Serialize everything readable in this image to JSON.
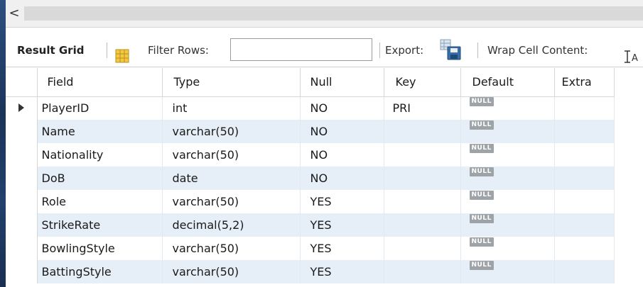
{
  "scrollbar": {
    "left_arrow": "<"
  },
  "toolbar": {
    "result_grid_label": "Result Grid",
    "filter_label": "Filter Rows:",
    "filter_value": "",
    "export_label": "Export:",
    "wrap_label": "Wrap Cell Content:"
  },
  "table": {
    "columns": [
      "Field",
      "Type",
      "Null",
      "Key",
      "Default",
      "Extra"
    ],
    "rows": [
      {
        "field": "PlayerID",
        "type": "int",
        "null": "NO",
        "key": "PRI",
        "default": "NULL",
        "extra": ""
      },
      {
        "field": "Name",
        "type": "varchar(50)",
        "null": "NO",
        "key": "",
        "default": "NULL",
        "extra": ""
      },
      {
        "field": "Nationality",
        "type": "varchar(50)",
        "null": "NO",
        "key": "",
        "default": "NULL",
        "extra": ""
      },
      {
        "field": "DoB",
        "type": "date",
        "null": "NO",
        "key": "",
        "default": "NULL",
        "extra": ""
      },
      {
        "field": "Role",
        "type": "varchar(50)",
        "null": "YES",
        "key": "",
        "default": "NULL",
        "extra": ""
      },
      {
        "field": "StrikeRate",
        "type": "decimal(5,2)",
        "null": "YES",
        "key": "",
        "default": "NULL",
        "extra": ""
      },
      {
        "field": "BowlingStyle",
        "type": "varchar(50)",
        "null": "YES",
        "key": "",
        "default": "NULL",
        "extra": ""
      },
      {
        "field": "BattingStyle",
        "type": "varchar(50)",
        "null": "YES",
        "key": "",
        "default": "NULL",
        "extra": ""
      }
    ]
  },
  "icons": {
    "grid_icon": "grid-layout-icon",
    "export_icon": "export-save-icon",
    "wrap_icon": "wrap-text-icon",
    "row_marker": "current-row-arrow-icon"
  },
  "colors": {
    "alt_row": "#e6eef7",
    "null_badge": "#9ea3a8",
    "background": "#1b2a44"
  }
}
